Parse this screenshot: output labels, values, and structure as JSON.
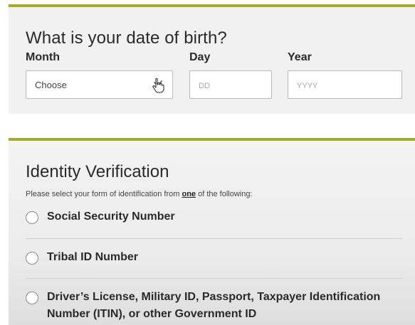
{
  "dob": {
    "title": "What is your date of birth?",
    "month": {
      "label": "Month",
      "value": "Choose"
    },
    "day": {
      "label": "Day",
      "placeholder": "DD"
    },
    "year": {
      "label": "Year",
      "placeholder": "YYYY"
    }
  },
  "identity": {
    "title": "Identity Verification",
    "instruction_prefix": "Please select your form of identification from ",
    "instruction_emphasis": "one",
    "instruction_suffix": " of the following:",
    "options": [
      {
        "label": "Social Security Number"
      },
      {
        "label": "Tribal ID Number"
      },
      {
        "label": "Driver’s License, Military ID, Passport, Taxpayer Identification Number (ITIN), or other Government ID"
      }
    ]
  },
  "colors": {
    "accent": "#a5ac2b",
    "card_bg": "#f1f1f1",
    "text": "#2a2a2a"
  },
  "icons": {
    "month_dropdown": "chevron-down-icon",
    "cursor": "pointer-hand-icon"
  }
}
